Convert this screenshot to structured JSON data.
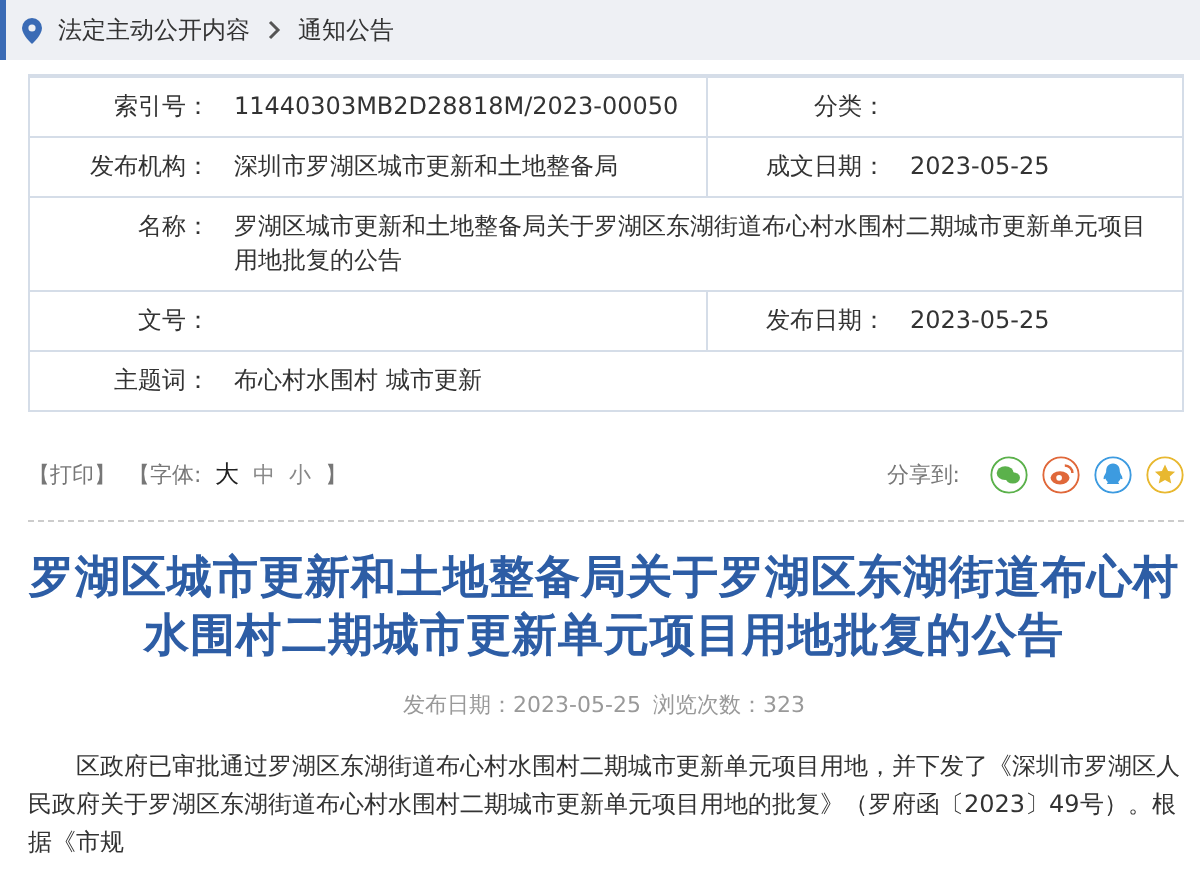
{
  "breadcrumb": [
    "法定主动公开内容",
    "通知公告"
  ],
  "info_rows": [
    {
      "cells": [
        {
          "label": "索引号：",
          "value": "11440303MB2D28818M/2023-00050"
        },
        {
          "label": "分类："
        }
      ]
    },
    {
      "cells": [
        {
          "label": "发布机构：",
          "value": "深圳市罗湖区城市更新和土地整备局"
        },
        {
          "label": "成文日期：",
          "value": "2023-05-25"
        }
      ]
    },
    {
      "cells": [
        {
          "label": "名称：",
          "value": "罗湖区城市更新和土地整备局关于罗湖区东湖街道布心村水围村二期城市更新单元项目用地批复的公告"
        }
      ]
    },
    {
      "cells": [
        {
          "label": "文号："
        },
        {
          "label": "发布日期：",
          "value": "2023-05-25"
        }
      ]
    },
    {
      "cells": [
        {
          "label": "主题词：",
          "value": "布心村水围村 城市更新"
        }
      ]
    }
  ],
  "tools": {
    "print": "【打印】",
    "font_prefix": "【字体:",
    "font_sizes": [
      {
        "label": "大",
        "selected": true
      },
      {
        "label": "中",
        "selected": false
      },
      {
        "label": "小",
        "selected": false
      }
    ],
    "font_suffix": "】",
    "share_label": "分享到:",
    "share": [
      {
        "kind": "wechat"
      },
      {
        "kind": "weibo"
      },
      {
        "kind": "qq"
      },
      {
        "kind": "favorite"
      }
    ]
  },
  "article": {
    "title": "罗湖区城市更新和土地整备局关于罗湖区东湖街道布心村水围村二期城市更新单元项目用地批复的公告",
    "meta": [
      "发布日期：2023-05-25",
      "浏览次数：323"
    ],
    "paragraph": "区政府已审批通过罗湖区东湖街道布心村水围村二期城市更新单元项目用地，并下发了《深圳市罗湖区人民政府关于罗湖区东湖街道布心村水围村二期城市更新单元项目用地的批复》（罗府函〔2023〕49号）。根据《市规"
  }
}
